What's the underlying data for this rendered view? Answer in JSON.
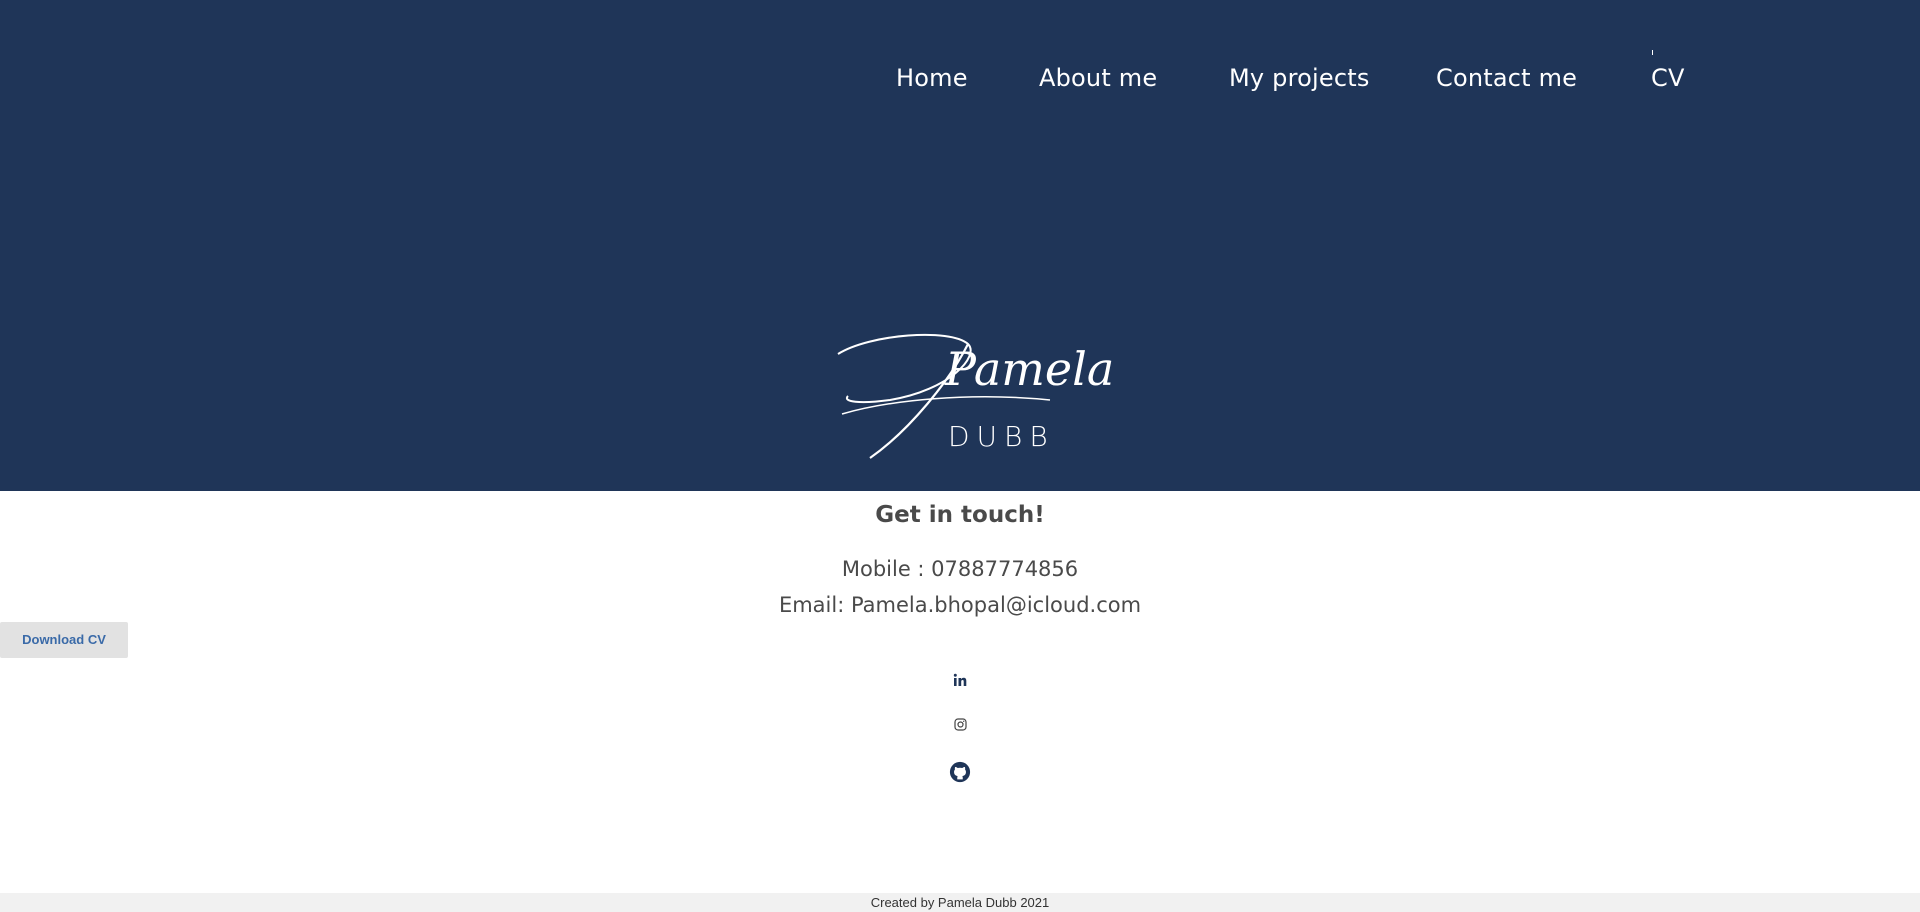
{
  "nav": {
    "items": [
      {
        "label": "Home"
      },
      {
        "label": "About me"
      },
      {
        "label": "My projects"
      },
      {
        "label": "Contact me"
      },
      {
        "label": "CV"
      }
    ]
  },
  "logo": {
    "first_name": "Pamela",
    "last_name": "DUBB"
  },
  "contact": {
    "title": "Get in touch!",
    "mobile": "Mobile : 07887774856",
    "email": "Email: Pamela.bhopal@icloud.com"
  },
  "download_button": {
    "label": "Download CV"
  },
  "social": {
    "icons": [
      "linkedin-icon",
      "instagram-icon",
      "github-icon"
    ]
  },
  "footer": {
    "text": "Created by Pamela Dubb 2021"
  },
  "colors": {
    "header_bg": "#1f3558",
    "text_dark": "#4a4a4a",
    "button_text": "#3a6aa8",
    "footer_bg": "#f1f1f1"
  }
}
